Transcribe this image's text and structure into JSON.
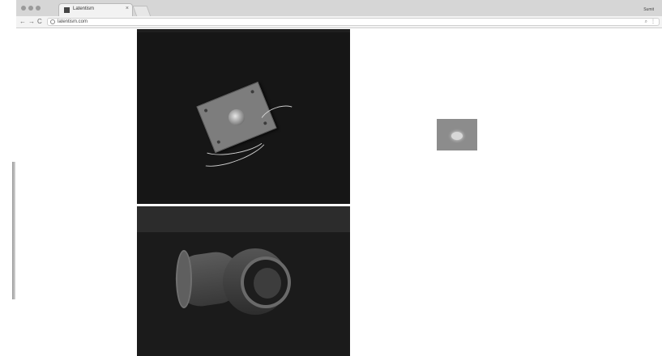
{
  "browser": {
    "tab_title": "Latentism",
    "tab_close": "×",
    "profile_name": "Sumit",
    "url": "latentism.com",
    "nav_back": "←",
    "nav_forward": "→",
    "nav_reload": "C",
    "search_icon": "⌕",
    "menu_icon": "⋮"
  },
  "content": {
    "images": [
      {
        "subject": "switch plate with wires",
        "tone": "dark"
      },
      {
        "subject": "pvc pipe elbow",
        "tone": "dark"
      }
    ],
    "thumbnail": {
      "subject": "blurred small object",
      "tone": "gray"
    }
  },
  "colors": {
    "tab_strip": "#d6d6d6",
    "toolbar": "#f3f3f3",
    "page_background": "#ffffff"
  }
}
